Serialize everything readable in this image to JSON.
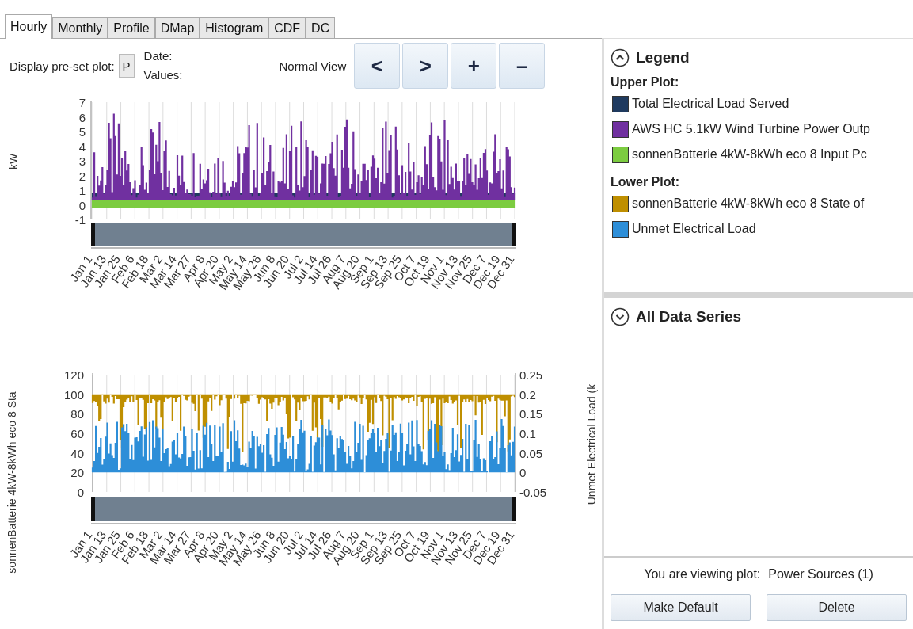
{
  "tabs": [
    {
      "label": "Hourly",
      "selected": true
    },
    {
      "label": "Monthly",
      "selected": false
    },
    {
      "label": "Profile",
      "selected": false
    },
    {
      "label": "DMap",
      "selected": false
    },
    {
      "label": "Histogram",
      "selected": false
    },
    {
      "label": "CDF",
      "selected": false
    },
    {
      "label": "DC",
      "selected": false
    }
  ],
  "toolbar": {
    "preset_label": "Display pre-set plot:",
    "preset_value": "P",
    "date_label": "Date:",
    "values_label": "Values:",
    "view_label": "Normal View",
    "buttons": [
      "<",
      ">",
      "+",
      "–"
    ]
  },
  "upper_plot": {
    "y_label": "kW",
    "y_ticks": [
      "7",
      "6",
      "5",
      "4",
      "3",
      "2",
      "1",
      "0",
      "-1"
    ],
    "x_ticks": [
      "Jan 1",
      "Jan 13",
      "Jan 25",
      "Feb 6",
      "Feb 18",
      "Mar 2",
      "Mar 14",
      "Mar 27",
      "Apr 8",
      "Apr 20",
      "May 2",
      "May 14",
      "May 26",
      "Jun 8",
      "Jun 20",
      "Jul 2",
      "Jul 14",
      "Jul 26",
      "Aug 7",
      "Aug 20",
      "Sep 1",
      "Sep 13",
      "Sep 25",
      "Oct 7",
      "Oct 19",
      "Nov 1",
      "Nov 13",
      "Nov 25",
      "Dec 7",
      "Dec 19",
      "Dec 31"
    ]
  },
  "lower_plot": {
    "y_label": "sonnenBatterie 4kW-8kWh eco 8 Sta",
    "y_ticks": [
      "120",
      "100",
      "80",
      "60",
      "40",
      "20",
      "0"
    ],
    "right_label": "Unmet Electrical Load (k",
    "right_ticks": [
      "0.25",
      "0.2",
      "0.15",
      "0.1",
      "0.05",
      "0",
      "-0.05"
    ],
    "x_ticks": [
      "Jan 1",
      "Jan 13",
      "Jan 25",
      "Feb 6",
      "Feb 18",
      "Mar 2",
      "Mar 14",
      "Mar 27",
      "Apr 8",
      "Apr 20",
      "May 2",
      "May 14",
      "May 26",
      "Jun 8",
      "Jun 20",
      "Jul 2",
      "Jul 14",
      "Jul 26",
      "Aug 7",
      "Aug 20",
      "Sep 1",
      "Sep 13",
      "Sep 25",
      "Oct 7",
      "Oct 19",
      "Nov 1",
      "Nov 13",
      "Nov 25",
      "Dec 7",
      "Dec 19",
      "Dec 31"
    ]
  },
  "legend": {
    "title": "Legend",
    "expanded": true,
    "groups": [
      {
        "title": "Upper Plot:",
        "items": [
          {
            "label": "Total Electrical Load Served",
            "color": "#1f3a5f",
            "kind": "area"
          },
          {
            "label": "AWS HC 5.1kW Wind Turbine Power Outp",
            "color": "#7030a0",
            "kind": "bars"
          },
          {
            "label": "sonnenBatterie 4kW-8kWh eco 8 Input Pc",
            "color": "#7ccc40",
            "kind": "band"
          }
        ]
      },
      {
        "title": "Lower Plot:",
        "items": [
          {
            "label": "sonnenBatterie 4kW-8kWh eco 8 State of",
            "color": "#bf8f00",
            "kind": "line"
          },
          {
            "label": "Unmet Electrical Load",
            "color": "#2d8ed8",
            "kind": "bars"
          }
        ]
      }
    ]
  },
  "all_series": {
    "title": "All Data Series",
    "expanded": false
  },
  "footer": {
    "viewing_label": "You are viewing plot:",
    "viewing_value": "Power Sources (1)",
    "buttons": [
      "Make Default",
      "Delete"
    ]
  }
}
